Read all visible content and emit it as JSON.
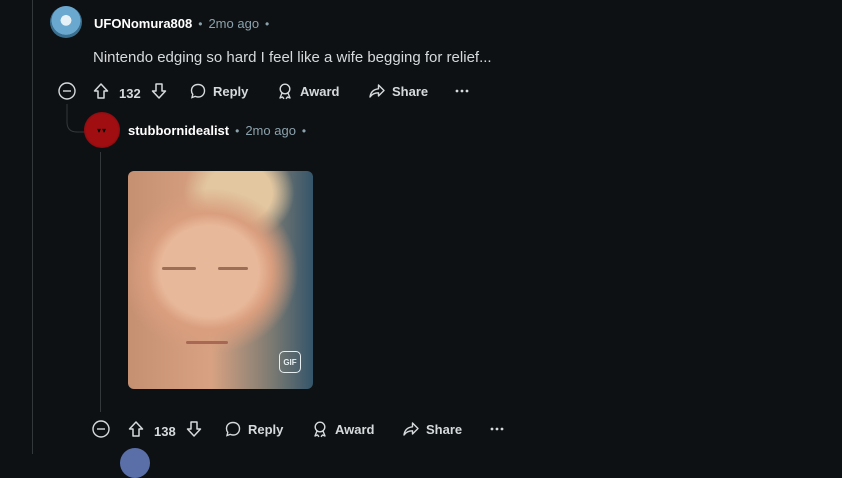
{
  "comment1": {
    "username": "UFONomura808",
    "time": "2mo ago",
    "text": "Nintendo edging so hard I feel like a wife begging for relief...",
    "votes": "132",
    "reply_label": "Reply",
    "award_label": "Award",
    "share_label": "Share"
  },
  "comment2": {
    "username": "stubbornidealist",
    "time": "2mo ago",
    "gif_label": "GIF",
    "votes": "138",
    "reply_label": "Reply",
    "award_label": "Award",
    "share_label": "Share"
  },
  "colors": {
    "background": "#0e1113",
    "text": "#d7dadc",
    "meta": "#8ba2ad",
    "thread_line": "#33383b"
  }
}
